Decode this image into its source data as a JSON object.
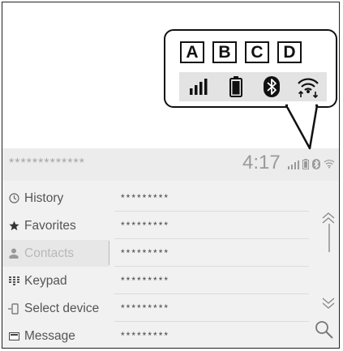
{
  "callout": {
    "letters": [
      "A",
      "B",
      "C",
      "D"
    ],
    "icons": [
      "signal-strength-icon",
      "battery-icon",
      "bluetooth-icon",
      "wifi-transfer-icon"
    ]
  },
  "status_bar": {
    "device_name": "*************",
    "clock": "4:17",
    "icons": [
      "signal-strength-icon",
      "battery-icon",
      "bluetooth-icon",
      "wifi-icon"
    ]
  },
  "sidebar": {
    "items": [
      {
        "label": "History",
        "icon": "clock-icon",
        "active": false
      },
      {
        "label": "Favorites",
        "icon": "star-icon",
        "active": false
      },
      {
        "label": "Contacts",
        "icon": "person-icon",
        "active": true
      },
      {
        "label": "Keypad",
        "icon": "keypad-icon",
        "active": false
      },
      {
        "label": "Select device",
        "icon": "phone-device-icon",
        "active": false
      },
      {
        "label": "Message",
        "icon": "envelope-icon",
        "active": false
      }
    ]
  },
  "contacts": [
    "*********",
    "*********",
    "*********",
    "*********",
    "*********",
    "*********"
  ],
  "controls": {
    "scroll_up_icon": "double-chevron-up-icon",
    "scroll_down_icon": "double-chevron-down-icon",
    "search_icon": "search-icon"
  }
}
